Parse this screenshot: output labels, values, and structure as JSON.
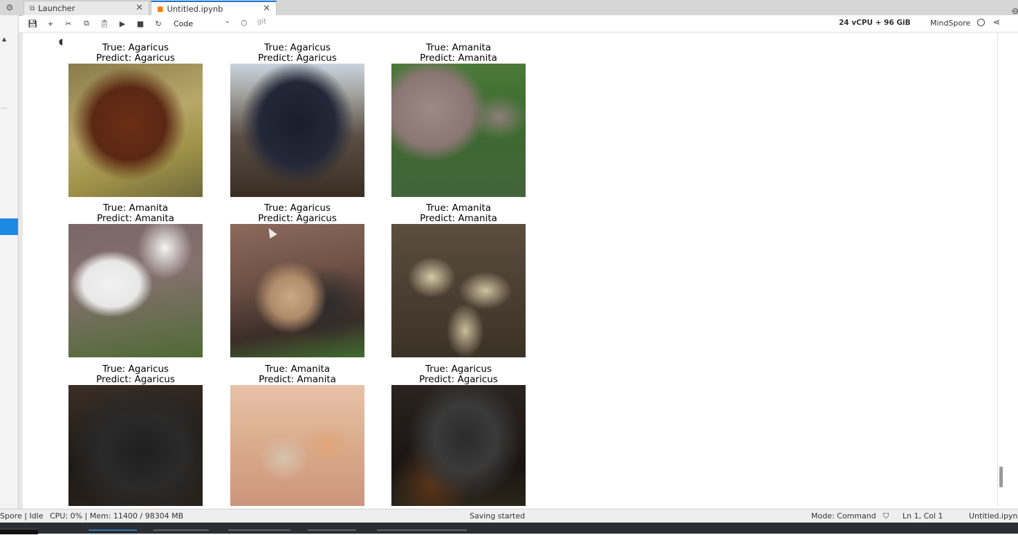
{
  "tabs": [
    {
      "label": "Launcher",
      "icon": "external-link-icon",
      "active": false
    },
    {
      "label": "Untitled.ipynb",
      "icon": "notebook-icon",
      "active": true
    }
  ],
  "toolbar": {
    "cell_type": "Code",
    "git_label": "git",
    "resources": "24 vCPU + 96 GiB",
    "kernel_name": "MindSpore"
  },
  "predictions": [
    {
      "true_label": "True: Agaricus",
      "pred_label": "Predict: Agaricus"
    },
    {
      "true_label": "True: Agaricus",
      "pred_label": "Predict: Agaricus"
    },
    {
      "true_label": "True: Amanita",
      "pred_label": "Predict: Amanita"
    },
    {
      "true_label": "True: Amanita",
      "pred_label": "Predict: Amanita"
    },
    {
      "true_label": "True: Agaricus",
      "pred_label": "Predict: Agaricus"
    },
    {
      "true_label": "True: Amanita",
      "pred_label": "Predict: Amanita"
    },
    {
      "true_label": "True: Agaricus",
      "pred_label": "Predict: Agaricus"
    },
    {
      "true_label": "True: Amanita",
      "pred_label": "Predict: Amanita"
    },
    {
      "true_label": "True: Agaricus",
      "pred_label": "Predict: Agaricus"
    }
  ],
  "status": {
    "kernel_state": "Spore | Idle",
    "resources": "CPU: 0% | Mem: 11400 / 98304 MB",
    "message": "Saving started",
    "mode": "Mode: Command",
    "cursor_pos": "Ln 1, Col 1",
    "filename": "Untitled.ipynb"
  },
  "colors": {
    "accent": "#1976d2",
    "sidebar_active": "#1e88e5",
    "notebook_icon": "#f57c00"
  }
}
